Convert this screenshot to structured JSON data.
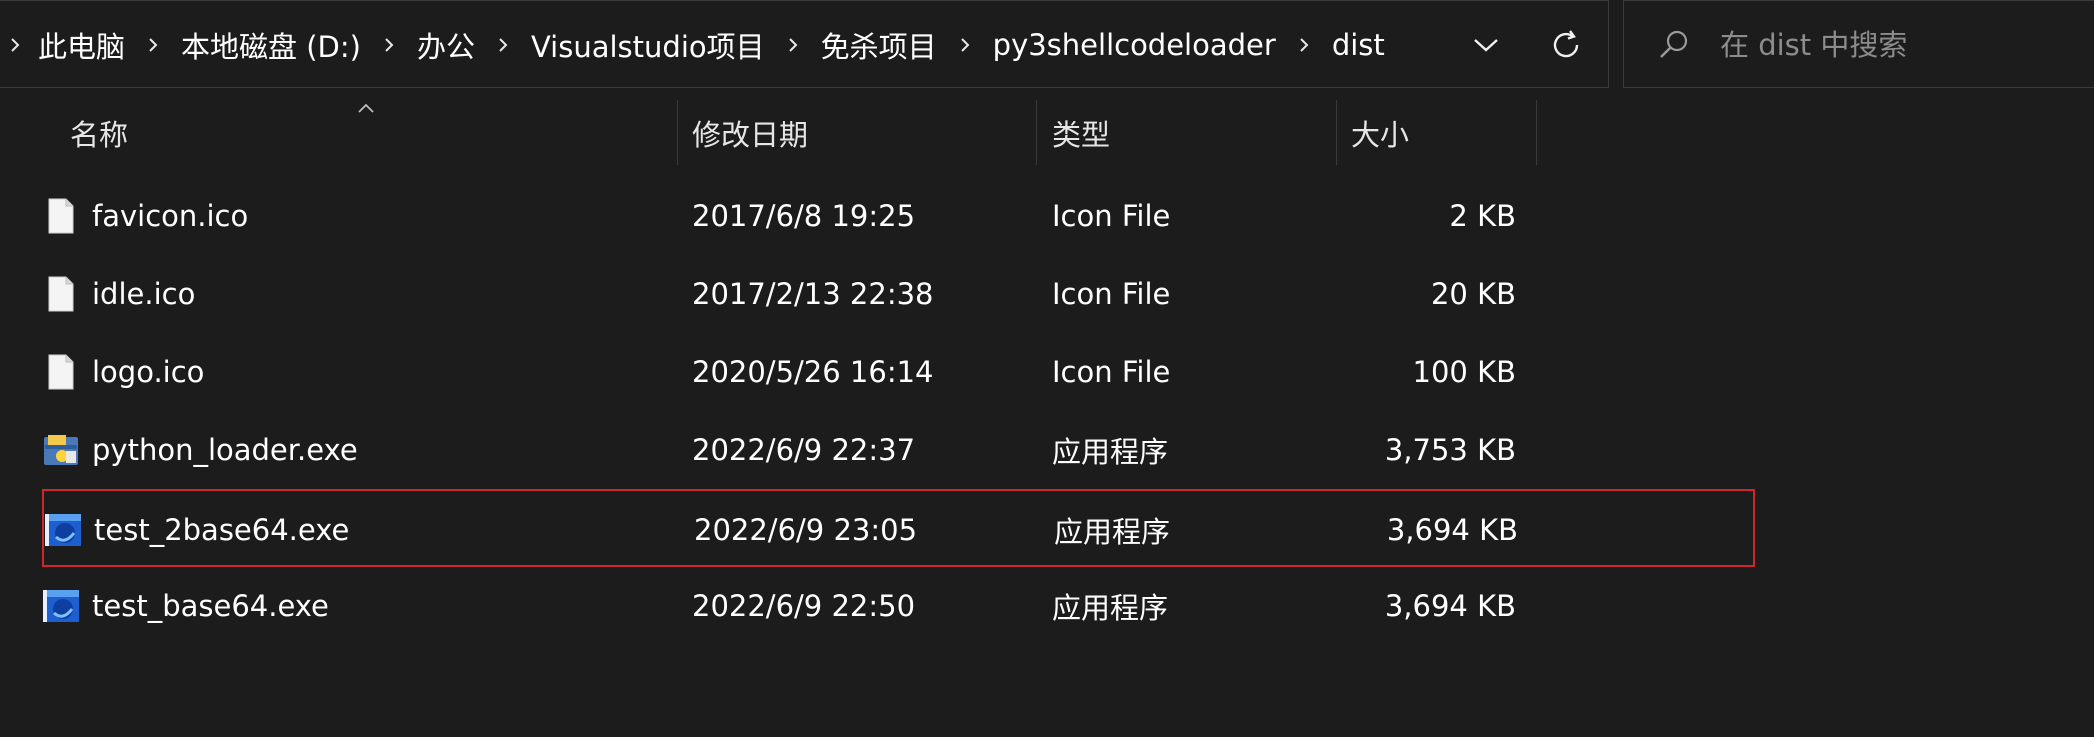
{
  "breadcrumb": {
    "items": [
      "此电脑",
      "本地磁盘 (D:)",
      "办公",
      "Visualstudio项目",
      "免杀项目",
      "py3shellcodeloader",
      "dist"
    ]
  },
  "search": {
    "placeholder": "在 dist 中搜索"
  },
  "columns": {
    "name": "名称",
    "modified": "修改日期",
    "type": "类型",
    "size": "大小"
  },
  "files": [
    {
      "name": "favicon.ico",
      "modified": "2017/6/8 19:25",
      "type": "Icon File",
      "size": "2 KB",
      "icon": "generic-file-icon"
    },
    {
      "name": "idle.ico",
      "modified": "2017/2/13 22:38",
      "type": "Icon File",
      "size": "20 KB",
      "icon": "generic-file-icon"
    },
    {
      "name": "logo.ico",
      "modified": "2020/5/26 16:14",
      "type": "Icon File",
      "size": "100 KB",
      "icon": "generic-file-icon"
    },
    {
      "name": "python_loader.exe",
      "modified": "2022/6/9 22:37",
      "type": "应用程序",
      "size": "3,753 KB",
      "icon": "python-app-icon"
    },
    {
      "name": "test_2base64.exe",
      "modified": "2022/6/9 23:05",
      "type": "应用程序",
      "size": "3,694 KB",
      "icon": "exe-app-icon",
      "highlighted": true
    },
    {
      "name": "test_base64.exe",
      "modified": "2022/6/9 22:50",
      "type": "应用程序",
      "size": "3,694 KB",
      "icon": "exe-app-icon"
    }
  ],
  "colors": {
    "background": "#1c1c1c",
    "border": "#3b3b3b",
    "highlight_outline": "#d0262e",
    "text": "#ffffff",
    "placeholder": "#8c8c8c"
  }
}
